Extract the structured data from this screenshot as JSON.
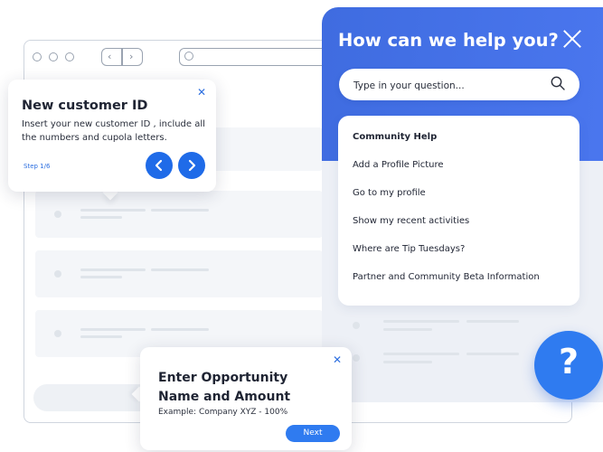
{
  "help_panel": {
    "title": "How can we help you?",
    "search_placeholder": "Type in your question...",
    "section_title": "Community Help",
    "items": [
      "Add a Profile Picture",
      "Go to my profile",
      "Show my recent activities",
      "Where are Tip Tuesdays?",
      "Partner and Community Beta Information"
    ],
    "fab_label": "?"
  },
  "tooltip_step": {
    "title": "New customer ID",
    "body": "Insert your new customer ID , include all the numbers and cupola letters.",
    "step": "Step 1/6"
  },
  "tooltip_next": {
    "title": "Enter Opportunity Name and Amount",
    "body": "Example: Company XYZ - 100%",
    "button": "Next"
  },
  "colors": {
    "accent": "#2f7bf0",
    "header_blue": "#4470e8",
    "panel_bg": "#edf0f6"
  }
}
